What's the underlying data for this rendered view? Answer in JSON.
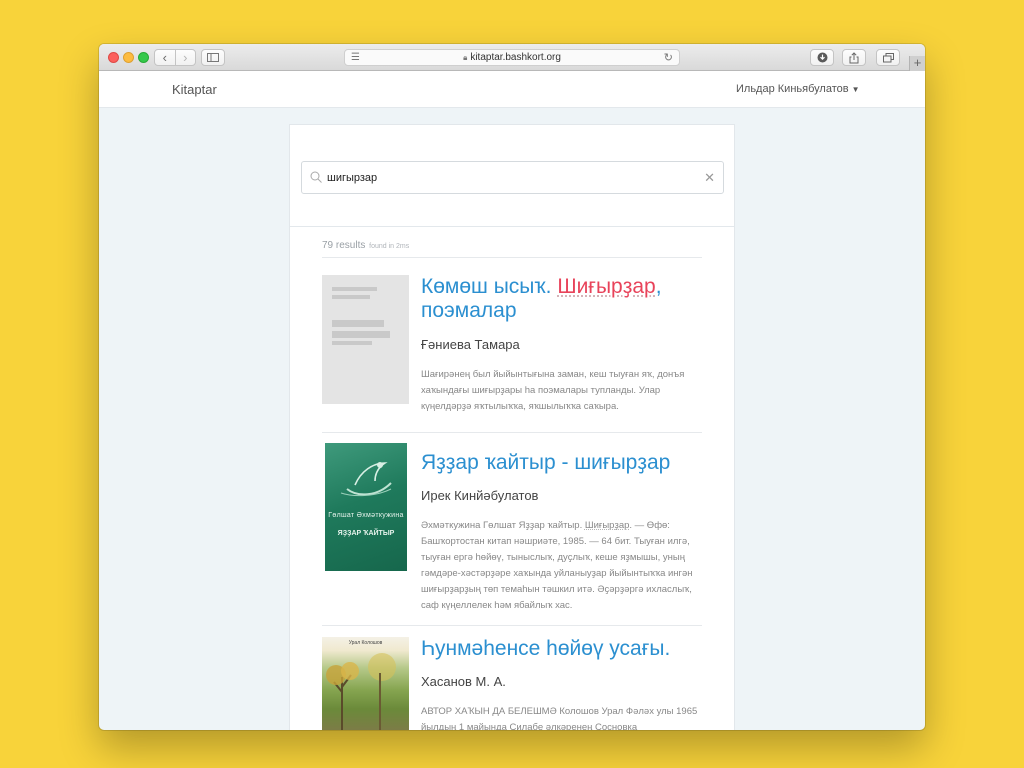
{
  "browser": {
    "url": "kitaptar.bashkort.org"
  },
  "header": {
    "brand": "Kitaptar",
    "user": "Ильдар Киньябулатов"
  },
  "search": {
    "query": "шигырзар"
  },
  "results_meta": {
    "count": "79 results",
    "timing": "found in 2ms"
  },
  "results": [
    {
      "title_parts": [
        "Көмөш ысыҡ. ",
        "Шиғырҙар",
        ", поэмалар"
      ],
      "author": "Ғәниева Тамара",
      "description": "Шағирәнең был йыйынтығына заман, кеш тыуған яҡ, донъя хаҡындағы шиғырҙары һа поэмалары тупланды. Улар күңелдәрҙә яҡтылыҡҡа, яҡшылыҡҡа саҡыра."
    },
    {
      "title": "Яҙҙар ҡайтыр - шиғырҙар",
      "author": "Ирек Кинйәбулатов",
      "description_parts": [
        "Әхмәткужина Гөлшат Яҙҙар ҡайтыр. ",
        "Шиғырҙар",
        ". — Өфө: Башҡортостан китап нәшриәте, 1985. — 64 бит. Тыуған илгә, тыуған ергә һөйөү, тыныслыҡ, дуҫлыҡ, кеше яҙмышы, уның гәмдәре-хәстәрҙәре хаҡында уйланыуҙар йыйынтыҡҡа ингән шиғырҙарҙың төп темаһын тәшкил итә. Әҫәрҙәргә ихласлыҡ, саф күңеллелек һәм ябайлыҡ хас."
      ],
      "cover_author": "Гөлшат Әхмәткужина",
      "cover_title": "ЯҘҘАР ҠАЙТЫР"
    },
    {
      "title": "Һунмәһенсе һөйөү усағы.",
      "author": "Хасанов М. А.",
      "description": "АВТОР ХАҠЫН ДА БЕЛЕШМӘ Колошов Урал Фәләх улы 1965 йылдың 1 майында Силабе әлкәренең Сосновка",
      "cover_author": "Урал Колошов"
    }
  ],
  "colors": {
    "link": "#2b8fd0",
    "highlight": "#e8435a",
    "page_bg": "#f8d33a"
  }
}
